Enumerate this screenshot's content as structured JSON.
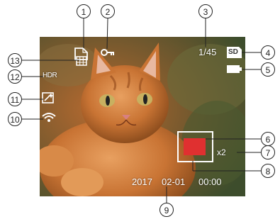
{
  "screen": {
    "image_count": "1/45",
    "storage_badge": "SD",
    "hdr_label": "HDR",
    "zoom": "x2",
    "date_year": "2017",
    "date_month_day": "02-01",
    "time": "00:00"
  },
  "callouts": [
    "1",
    "2",
    "3",
    "4",
    "5",
    "6",
    "7",
    "8",
    "9",
    "10",
    "11",
    "12",
    "13"
  ],
  "icons": {
    "c1": "document-icon",
    "c2": "key-lock-icon",
    "c3": "image-count",
    "c4": "sd-card-icon",
    "c5": "battery-icon",
    "c6": "zoom-frame",
    "c7": "zoom-ratio",
    "c8": "zoom-position-box",
    "c9": "date-time",
    "c10": "wifi-icon",
    "c11": "effect-icon",
    "c12": "hdr-icon",
    "c13": "grid-icon"
  },
  "colors": {
    "zoom_box": "#e03030",
    "frame": "#ffffff",
    "callout_border": "#222222"
  }
}
